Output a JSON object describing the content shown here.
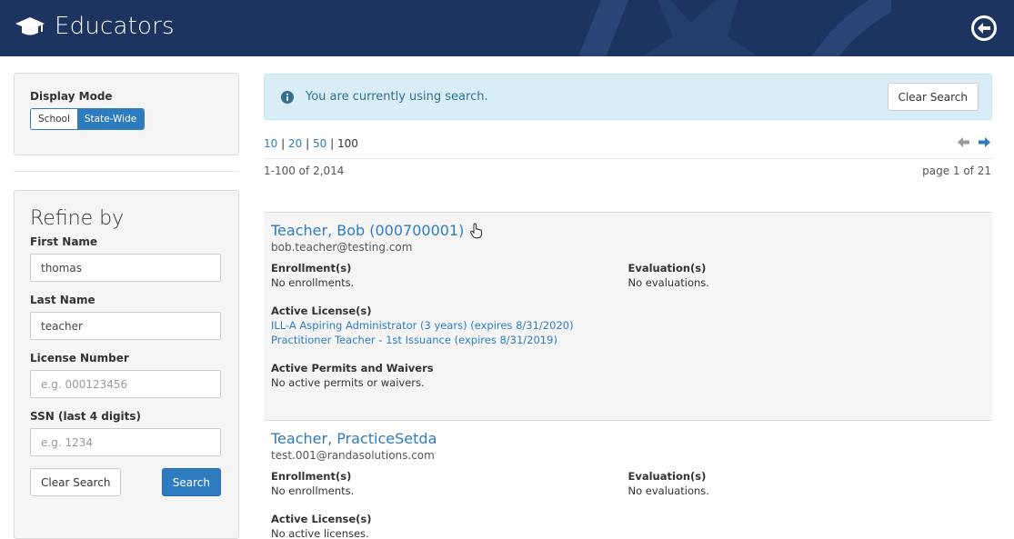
{
  "header": {
    "title": "Educators",
    "brand_color": "#1d3461",
    "icons": {
      "logo": "graduation-cap-icon",
      "back": "arrow-circle-left-icon"
    }
  },
  "display_mode": {
    "label": "Display Mode",
    "options": [
      "School",
      "State-Wide"
    ],
    "selected": "State-Wide"
  },
  "refine": {
    "title": "Refine by",
    "first_name": {
      "label": "First Name",
      "value": "thomas",
      "placeholder": ""
    },
    "last_name": {
      "label": "Last Name",
      "value": "teacher",
      "placeholder": ""
    },
    "license_number": {
      "label": "License Number",
      "value": "",
      "placeholder": "e.g. 000123456"
    },
    "ssn": {
      "label": "SSN (last 4 digits)",
      "value": "",
      "placeholder": "e.g. 1234"
    },
    "clear_label": "Clear Search",
    "search_label": "Search"
  },
  "alert": {
    "message": "You are currently using search.",
    "clear_label": "Clear Search",
    "icon": "info-circle-icon"
  },
  "pagination": {
    "sizes": [
      "10",
      "20",
      "50",
      "100"
    ],
    "selected_size": "100",
    "separator": "|",
    "range": "1-100 of 2,014",
    "page_info": "page 1 of 21"
  },
  "results": [
    {
      "name": "Teacher, Bob (000700001)",
      "email": "bob.teacher@testing.com",
      "enrollments_label": "Enrollment(s)",
      "enrollments": "No enrollments.",
      "evaluations_label": "Evaluation(s)",
      "evaluations": "No evaluations.",
      "licenses_label": "Active License(s)",
      "licenses": [
        "ILL-A Aspiring Administrator (3 years) (expires 8/31/2020)",
        "Practitioner Teacher - 1st Issuance (expires 8/31/2019)"
      ],
      "permits_label": "Active Permits and Waivers",
      "permits": "No active permits or waivers."
    },
    {
      "name": "Teacher, PracticeSetda",
      "email": "test.001@randasolutions.com",
      "enrollments_label": "Enrollment(s)",
      "enrollments": "No enrollments.",
      "evaluations_label": "Evaluation(s)",
      "evaluations": "No evaluations.",
      "licenses_label": "Active License(s)",
      "licenses_empty": "No active licenses."
    }
  ],
  "colors": {
    "link": "#2f7bbf",
    "alert_bg": "#d9edf7",
    "alert_text": "#31708f"
  }
}
